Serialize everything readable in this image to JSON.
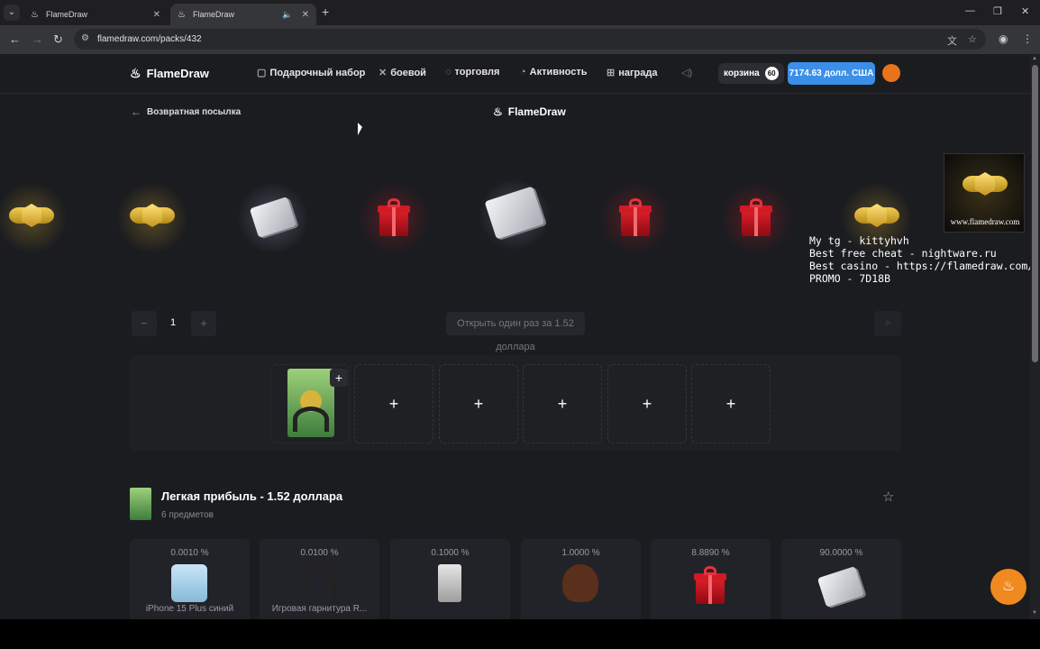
{
  "browser": {
    "tabs": [
      {
        "title": "FlameDraw",
        "active": false
      },
      {
        "title": "FlameDraw",
        "active": true
      }
    ],
    "url": "flamedraw.com/packs/432"
  },
  "header": {
    "logo": "FlameDraw",
    "nav": [
      {
        "label": "Подарочный набор",
        "icon": "gift-box-icon"
      },
      {
        "label": "боевой",
        "icon": "crossed-swords-icon"
      },
      {
        "label": "торговля",
        "icon": "trade-icon"
      },
      {
        "label": "Активность",
        "icon": "gauge-icon"
      },
      {
        "label": "награда",
        "icon": "gift-icon"
      }
    ],
    "cart_label": "корзина",
    "cart_count": "60",
    "balance": "7174.63 долл. США"
  },
  "page": {
    "back_label": "Возвратная посылка",
    "center_logo": "FlameDraw"
  },
  "reel": [
    {
      "kind": "badge",
      "glow": "gold"
    },
    {
      "kind": "badge",
      "glow": "gold"
    },
    {
      "kind": "ticket",
      "glow": "white"
    },
    {
      "kind": "gift",
      "glow": "red"
    },
    {
      "kind": "ticket",
      "glow": "white",
      "center": true
    },
    {
      "kind": "gift",
      "glow": "red"
    },
    {
      "kind": "gift",
      "glow": "red"
    },
    {
      "kind": "badge",
      "glow": "gold"
    }
  ],
  "ad": {
    "site": "www.flamedraw.com",
    "overlay_lines": "My tg - kittyhvh\nBest free cheat - nightware.ru\nBest casino - https://flamedraw.com/\nPROMO - 7D18B"
  },
  "controls": {
    "qty": "1",
    "minus": "−",
    "plus": "+",
    "open_label": "Открыть один раз за 1.52 доллара",
    "fast_icon": "lightning-icon"
  },
  "slots": {
    "add_symbol": "+",
    "count_empty": 5
  },
  "case": {
    "title": "Легкая прибыль - 1.52 доллара",
    "subtitle": "6 предметов"
  },
  "drops": [
    {
      "pct": "0.0010 %",
      "name": "iPhone 15 Plus синий",
      "img": "phone"
    },
    {
      "pct": "0.0100 %",
      "name": "Игровая гарнитура R...",
      "img": "headset"
    },
    {
      "pct": "0.1000 %",
      "name": "",
      "img": "watch"
    },
    {
      "pct": "1.0000 %",
      "name": "",
      "img": "bear"
    },
    {
      "pct": "8.8890 %",
      "name": "",
      "img": "gift"
    },
    {
      "pct": "90.0000 %",
      "name": "",
      "img": "ticket"
    }
  ],
  "colors": {
    "accent": "#3b8fe8",
    "orange": "#f0891f",
    "page_bg": "#1b1c20"
  }
}
